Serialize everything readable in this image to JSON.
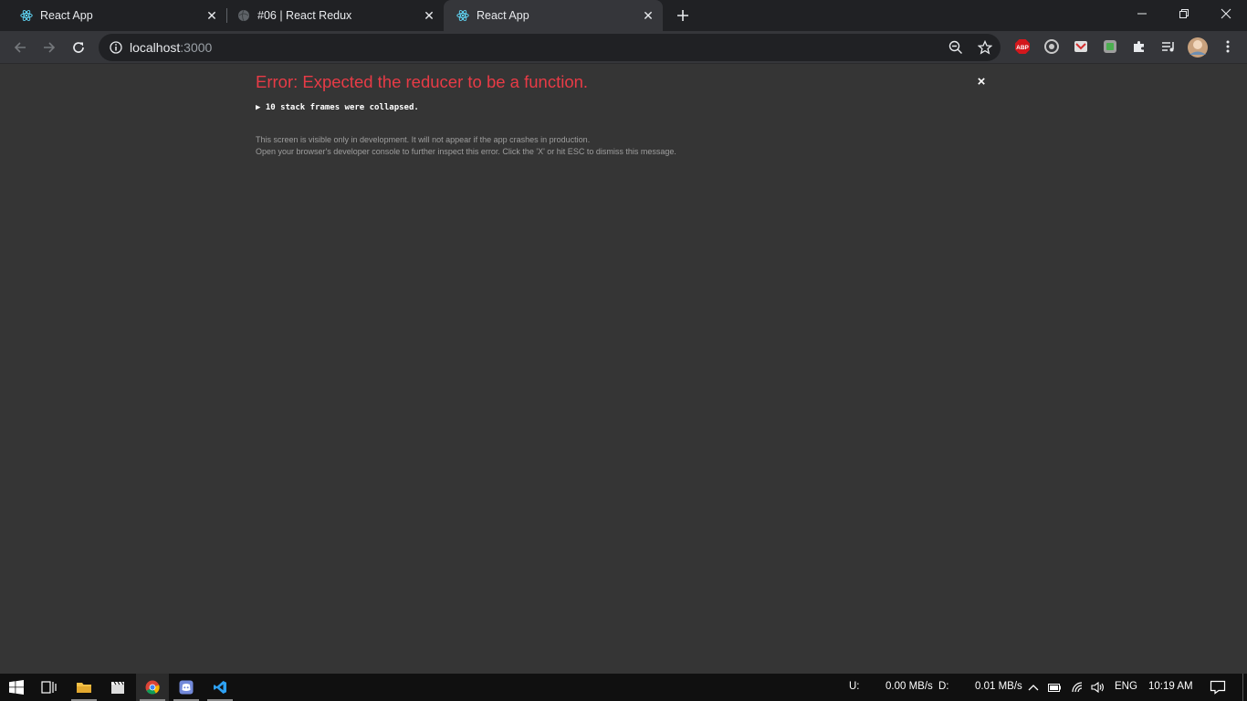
{
  "browser": {
    "tabs": [
      {
        "title": "React App",
        "favicon": "react-icon",
        "active": false
      },
      {
        "title": "#06 | React Redux",
        "favicon": "globe-icon",
        "active": false
      },
      {
        "title": "React App",
        "favicon": "react-icon",
        "active": true
      }
    ],
    "url_host": "localhost",
    "url_port": ":3000"
  },
  "extensions": [
    "adblock-plus-icon",
    "extension-icon",
    "extension-icon",
    "extension-icon",
    "puzzle-icon",
    "media-controls-icon",
    "profile-avatar",
    "menu-icon"
  ],
  "adblock_label": "ABP",
  "error": {
    "title": "Error: Expected the reducer to be a function.",
    "close_label": "×",
    "frames_text": "▶ 10 stack frames were collapsed.",
    "note_line1": "This screen is visible only in development. It will not appear if the app crashes in production.",
    "note_line2": "Open your browser's developer console to further inspect this error.  Click the 'X' or hit ESC to dismiss this message."
  },
  "taskbar": {
    "upload_label": "U:",
    "upload_value": "0.00 MB/s",
    "download_label": "D:",
    "download_value": "0.01 MB/s",
    "language": "ENG",
    "time": "10:19 AM"
  },
  "colors": {
    "error_red": "#e83b46",
    "page_bg": "#353535",
    "tab_bg": "#202124",
    "react_blue": "#61dafb"
  }
}
